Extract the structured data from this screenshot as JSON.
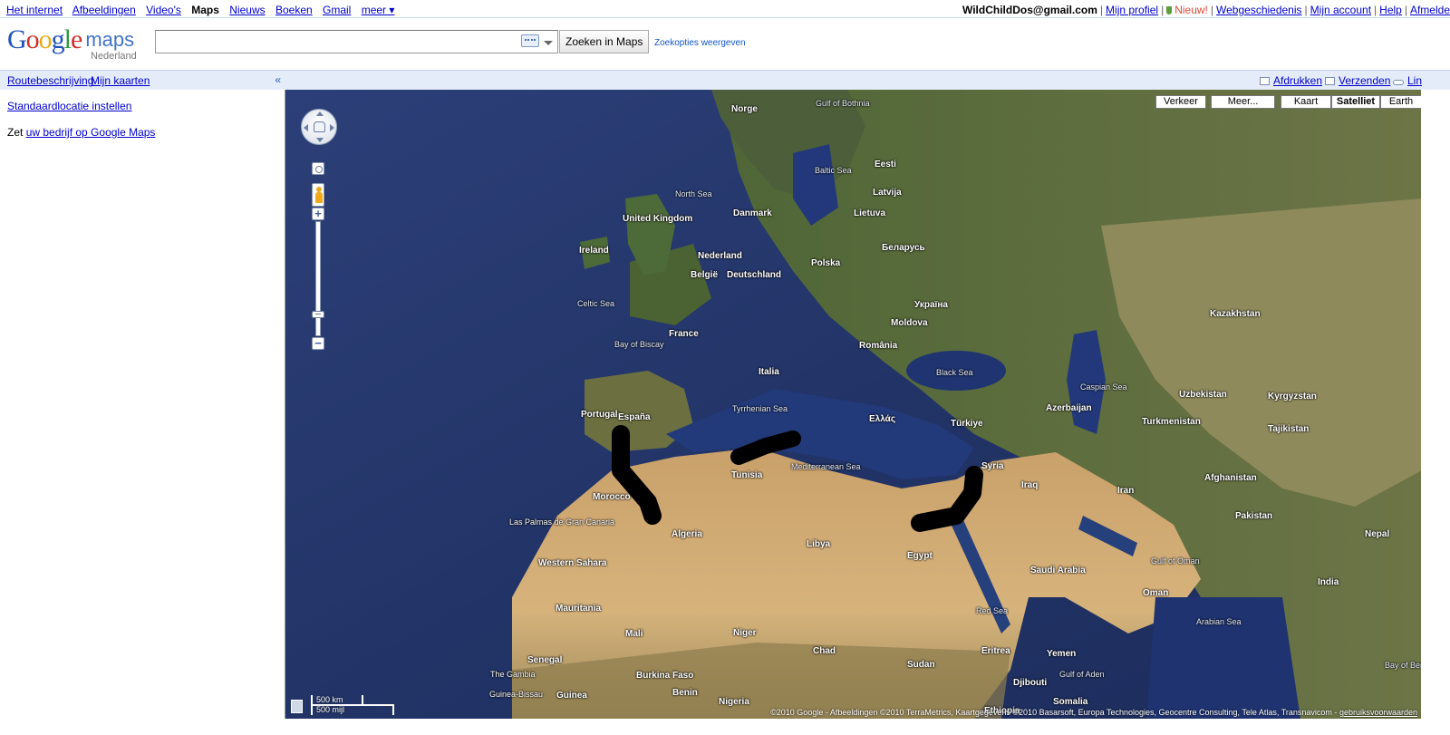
{
  "topbar": {
    "links": [
      {
        "label": "Het internet",
        "current": false
      },
      {
        "label": "Afbeeldingen",
        "current": false
      },
      {
        "label": "Video's",
        "current": false
      },
      {
        "label": "Maps",
        "current": true
      },
      {
        "label": "Nieuws",
        "current": false
      },
      {
        "label": "Boeken",
        "current": false
      },
      {
        "label": "Gmail",
        "current": false
      },
      {
        "label": "meer ▾",
        "current": false
      }
    ],
    "user_email": "WildChildDos@gmail.com",
    "my_profile": "Mijn profiel",
    "new_label": "Nieuw!",
    "web_history": "Webgeschiedenis",
    "my_account": "Mijn account",
    "help": "Help",
    "sign_out": "Afmelde"
  },
  "header": {
    "logo_google": "Google",
    "logo_maps": "maps",
    "logo_country": "Nederland",
    "search_value": "",
    "search_button": "Zoeken in Maps",
    "search_options": "Zoekopties weergeven"
  },
  "left_panel": {
    "directions": "Routebeschrijving",
    "my_maps": "Mijn kaarten",
    "collapse": "«",
    "default_location": "Standaardlocatie instellen",
    "business_prefix": "Zet",
    "business_link": "uw bedrijf op Google Maps"
  },
  "map_tools": {
    "print": "Afdrukken",
    "send": "Verzenden",
    "link": "Lin"
  },
  "map": {
    "type_buttons": {
      "traffic": "Verkeer",
      "more": "Meer...",
      "map": "Kaart",
      "satellite": "Satelliet",
      "earth": "Earth"
    },
    "active_type": "Satelliet",
    "scale_km": "500 km",
    "scale_mi": "500 mijl",
    "copyright": "©2010 Google - Afbeeldingen ©2010 TerraMetrics, Kaartgegevens ©2010 Basarsoft, Europa Technologies, Geocentre Consulting, Tele Atlas, Transnavicom -",
    "terms": "gebruiksvoorwaarden",
    "labels": {
      "north_sea": "North Sea",
      "norge": "Norge",
      "gulf_bothnia": "Gulf of Bothnia",
      "baltic_sea": "Baltic Sea",
      "united_kingdom": "United Kingdom",
      "ireland": "Ireland",
      "celtic_sea": "Celtic Sea",
      "danmark": "Danmark",
      "nederland": "Nederland",
      "deutschland": "Deutschland",
      "belgie": "België",
      "polska": "Polska",
      "france": "France",
      "bay_biscay": "Bay of Biscay",
      "espana": "España",
      "portugal": "Portugal",
      "italia": "Italia",
      "tyrrhenian": "Tyrrhenian Sea",
      "morocco": "Morocco",
      "algeria": "Algeria",
      "tunisia": "Tunisia",
      "libya": "Libya",
      "mediterranean": "Mediterranean Sea",
      "egypt": "Egypt",
      "turkiye": "Türkiye",
      "black_sea": "Black Sea",
      "ukraina": "Україна",
      "romania": "România",
      "belarus": "Беларусь",
      "latvija": "Latvija",
      "lietuva": "Lietuva",
      "eesti": "Eesti",
      "moldova": "Moldova",
      "kazakhstan": "Kazakhstan",
      "uzbekistan": "Uzbekistan",
      "turkmenistan": "Turkmenistan",
      "caspian": "Caspian Sea",
      "azerbaijan": "Azerbaijan",
      "syria": "Syria",
      "iraq": "Iraq",
      "iran": "Iran",
      "afghanistan": "Afghanistan",
      "pakistan": "Pakistan",
      "kyrgyzstan": "Kyrgyzstan",
      "tajikistan": "Tajikistan",
      "saudi": "Saudi Arabia",
      "gulf_oman": "Gulf of Oman",
      "oman": "Oman",
      "india": "India",
      "nepal": "Nepal",
      "arabian_sea": "Arabian Sea",
      "red_sea": "Red Sea",
      "yemen": "Yemen",
      "gulf_aden": "Gulf of Aden",
      "eritrea": "Eritrea",
      "djibouti": "Djibouti",
      "somalia": "Somalia",
      "ethiopia": "Ethiopia",
      "sudan": "Sudan",
      "chad": "Chad",
      "niger": "Niger",
      "mali": "Mali",
      "mauritania": "Mauritania",
      "western_sahara": "Western Sahara",
      "senegal": "Senegal",
      "gambia": "The Gambia",
      "guinea_bissau": "Guinea-Bissau",
      "guinea": "Guinea",
      "burkina": "Burkina Faso",
      "nigeria": "Nigeria",
      "benin": "Benin",
      "las_palmas": "Las Palmas de Gran Canaria",
      "greece": "Ελλάς",
      "bay_bengal": "Bay of Bengal"
    }
  }
}
